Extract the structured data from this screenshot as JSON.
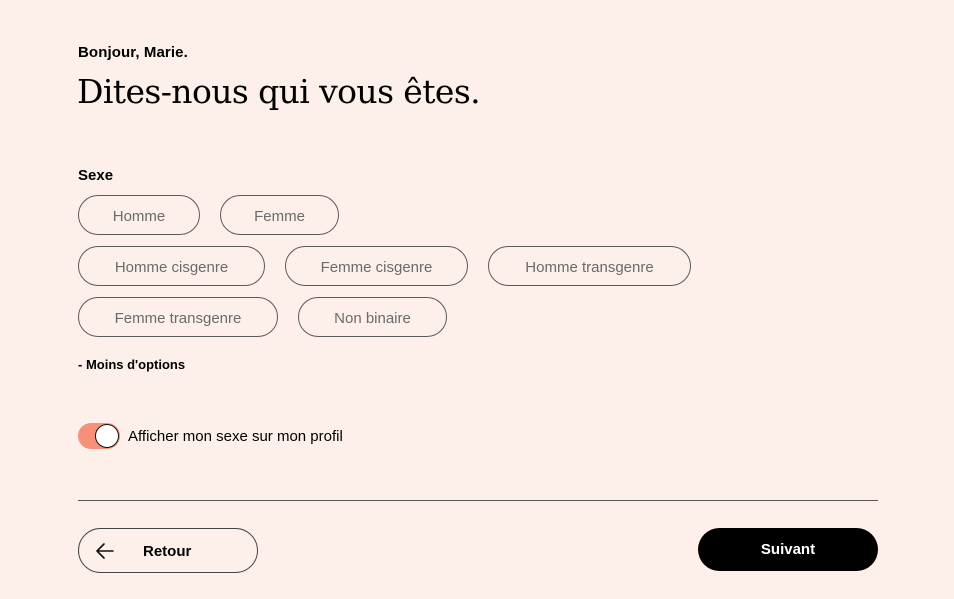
{
  "header": {
    "greeting": "Bonjour, Marie.",
    "title": "Dites-nous qui vous êtes."
  },
  "gender_section": {
    "label": "Sexe",
    "options": [
      "Homme",
      "Femme",
      "Homme cisgenre",
      "Femme cisgenre",
      "Homme transgenre",
      "Femme transgenre",
      "Non binaire"
    ],
    "less_options_label": "- Moins d'options"
  },
  "profile_toggle": {
    "label": "Afficher mon sexe sur mon profil",
    "checked": true,
    "color": "#f7907a"
  },
  "footer": {
    "back_label": "Retour",
    "back_icon": "arrow-left-icon",
    "next_label": "Suivant"
  },
  "colors": {
    "background": "#fdf0ea",
    "primary_button": "#000000"
  }
}
